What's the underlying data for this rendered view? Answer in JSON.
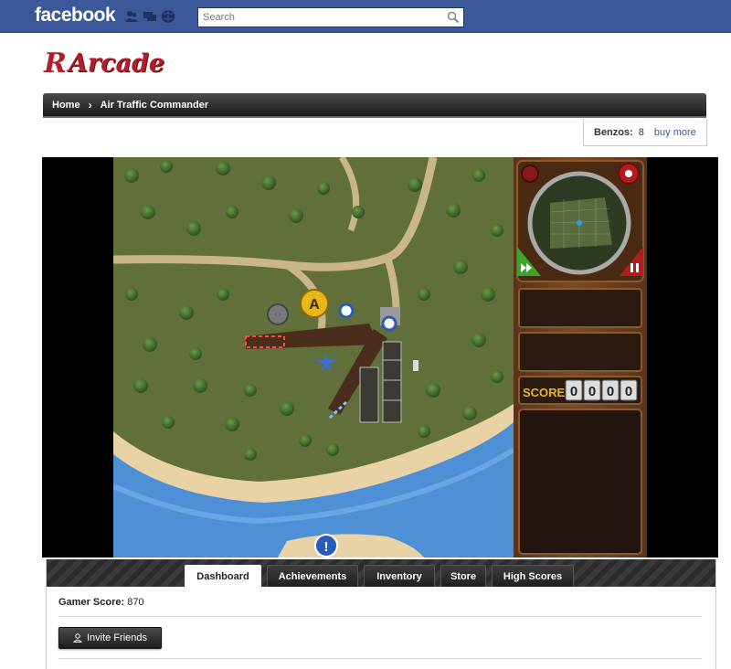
{
  "facebook": {
    "logo": "facebook",
    "search_placeholder": "Search",
    "icons": [
      "friend-requests-icon",
      "messages-icon",
      "notifications-icon",
      "search-icon"
    ]
  },
  "app": {
    "logo_badge": "R",
    "logo_text": "Arcade",
    "brand_color": "#b11e2a"
  },
  "breadcrumb": {
    "home": "Home",
    "separator": "›",
    "current": "Air Traffic Commander"
  },
  "benzos": {
    "label": "Benzos:",
    "count": "8",
    "buy_more": "buy more"
  },
  "game": {
    "title": "Air Traffic Commander",
    "airfield_marker": "A",
    "alert_marker": "!",
    "score_label": "SCORE",
    "score_digits": [
      "0",
      "0",
      "0",
      "0"
    ],
    "controls": [
      "fast-forward-icon",
      "pause-icon",
      "settings-gear-icon"
    ]
  },
  "tabs": [
    {
      "label": "Dashboard",
      "active": true
    },
    {
      "label": "Achievements",
      "active": false
    },
    {
      "label": "Inventory",
      "active": false
    },
    {
      "label": "Store",
      "active": false
    },
    {
      "label": "High Scores",
      "active": false
    }
  ],
  "dashboard": {
    "gamer_score_label": "Gamer Score:",
    "gamer_score_value": "870",
    "invite_button": "Invite Friends"
  },
  "colors": {
    "facebook_blue": "#3b5998",
    "link_blue": "#3b5998",
    "grass": "#5f6e2f",
    "sea": "#4f8fd6"
  }
}
